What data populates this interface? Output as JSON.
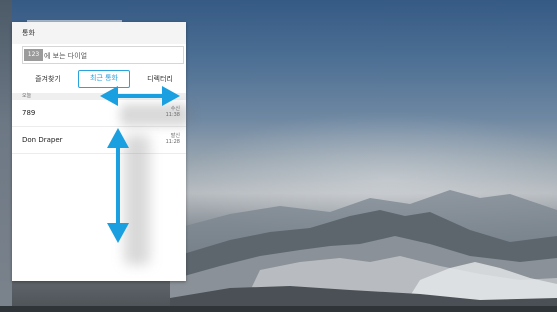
{
  "panel": {
    "title": "통화",
    "search": {
      "mode_label": "123",
      "placeholder": "에 보는 다이얼"
    },
    "tabs": [
      {
        "label": "즐겨찾기",
        "active": false
      },
      {
        "label": "최근 통화",
        "active": true
      },
      {
        "label": "디렉터리",
        "active": false
      }
    ],
    "section_label": "오늘",
    "calls": [
      {
        "name": "789",
        "type": "수신",
        "time": "11:38"
      },
      {
        "name": "Don Draper",
        "type": "발신",
        "time": "11:28"
      }
    ]
  },
  "gesture": {
    "arrow_color": "#1aa0e0",
    "horizontal": "left-right-swipe",
    "vertical": "up-down-swipe"
  },
  "background": {
    "scene": "mountain-landscape"
  }
}
